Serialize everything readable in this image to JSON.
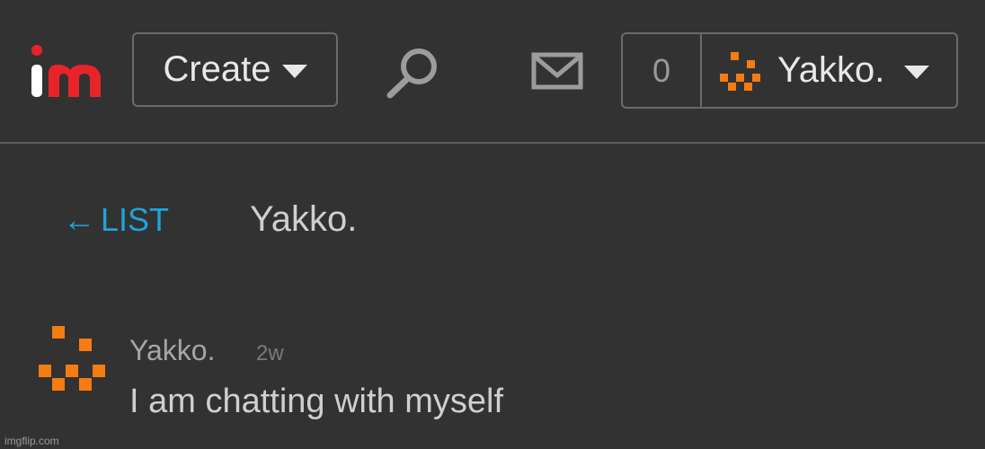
{
  "header": {
    "logo_icon": "imgflip-logo-icon",
    "create_label": "Create",
    "search_icon": "search-icon",
    "mail_icon": "envelope-icon",
    "notification_count": "0",
    "username": "Yakko.",
    "avatar_icon": "pixel-avatar-icon",
    "avatar_color": "#f47c12",
    "logo_colors": {
      "i": "#ffffff",
      "m": "#e8242a"
    }
  },
  "conversation": {
    "back_label": "LIST",
    "back_arrow": "←",
    "title": "Yakko."
  },
  "messages": [
    {
      "author": "Yakko.",
      "time": "2w",
      "text": "I am chatting with myself"
    }
  ],
  "watermark": "imgflip.com",
  "colors": {
    "background": "#323232",
    "link": "#1fa3db",
    "divider": "#5e5e5e"
  }
}
